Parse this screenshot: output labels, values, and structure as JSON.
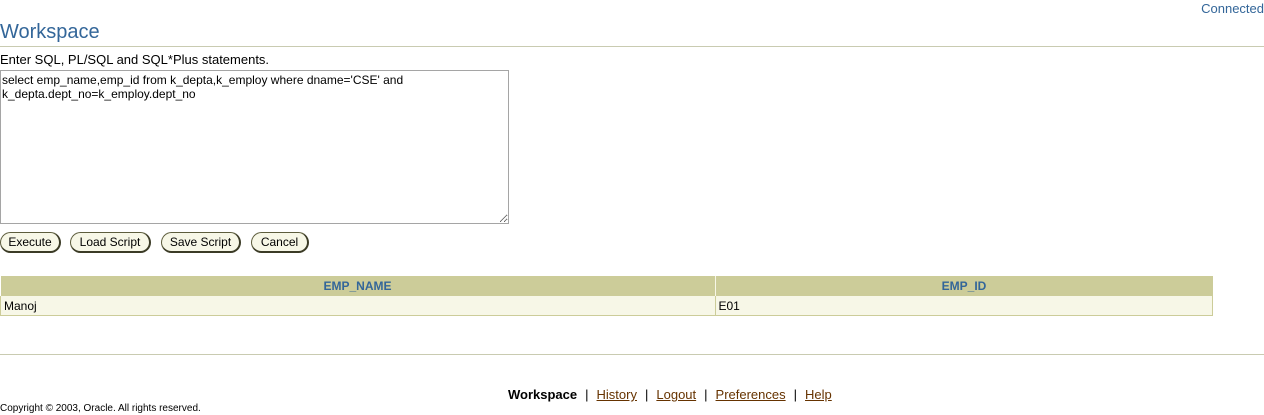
{
  "header": {
    "status": "Connected",
    "title": "Workspace"
  },
  "editor": {
    "instructions": "Enter SQL, PL/SQL and SQL*Plus statements.",
    "value": "select emp_name,emp_id from k_depta,k_employ where dname='CSE' and\nk_depta.dept_no=k_employ.dept_no"
  },
  "buttons": {
    "execute": "Execute",
    "load_script": "Load Script",
    "save_script": "Save Script",
    "cancel": "Cancel"
  },
  "results": {
    "columns": [
      "EMP_NAME",
      "EMP_ID"
    ],
    "rows": [
      [
        "Manoj",
        "E01"
      ]
    ]
  },
  "footer": {
    "nav": {
      "current": "Workspace",
      "history": "History",
      "logout": "Logout",
      "preferences": "Preferences",
      "help": "Help"
    },
    "copyright": "Copyright © 2003, Oracle. All rights reserved."
  },
  "colors": {
    "brand_blue": "#336699",
    "table_header": "#cccc99",
    "table_row": "#f7f7e7",
    "link": "#663300"
  }
}
